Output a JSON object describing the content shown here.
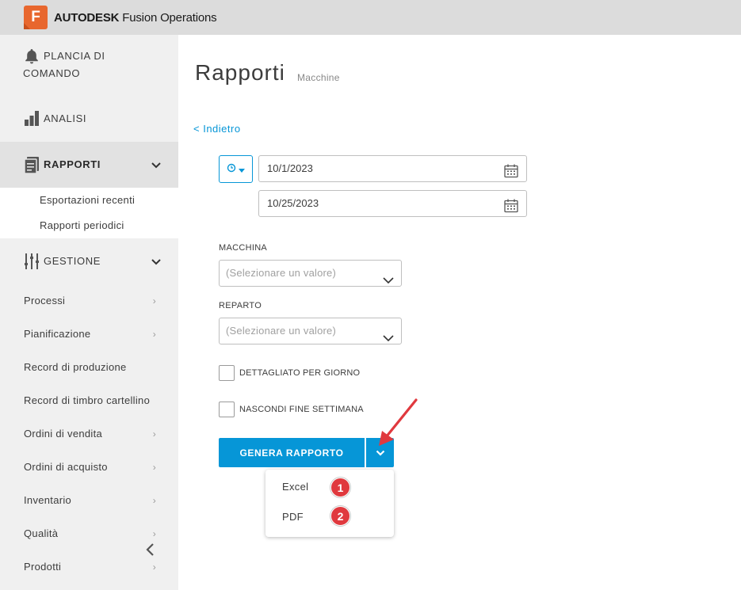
{
  "header": {
    "logo_letter": "F",
    "brand_bold": "AUTODESK",
    "brand_product": "Fusion Operations"
  },
  "sidebar": {
    "dashboard": {
      "label_line1": "PLANCIA DI",
      "label_line2": "COMANDO",
      "icon": "bell-icon"
    },
    "analytics": {
      "label": "ANALISI",
      "icon": "bar-chart-icon"
    },
    "reports": {
      "label": "RAPPORTI",
      "icon": "report-icon",
      "sub_items": [
        "Esportazioni recenti",
        "Rapporti periodici"
      ]
    },
    "management": {
      "label": "GESTIONE",
      "icon": "sliders-icon"
    },
    "items": [
      {
        "label": "Processi",
        "has_arrow": true
      },
      {
        "label": "Pianificazione",
        "has_arrow": true
      },
      {
        "label": "Record di produzione",
        "has_arrow": false
      },
      {
        "label": "Record di timbro cartellino",
        "has_arrow": false
      },
      {
        "label": "Ordini di vendita",
        "has_arrow": true
      },
      {
        "label": "Ordini di acquisto",
        "has_arrow": true
      },
      {
        "label": "Inventario",
        "has_arrow": true
      },
      {
        "label": "Qualità",
        "has_arrow": true
      },
      {
        "label": "Prodotti",
        "has_arrow": true
      }
    ]
  },
  "page": {
    "title": "Rapporti",
    "subtitle": "Macchine",
    "back_label": "< Indietro"
  },
  "filters": {
    "date_from": "10/1/2023",
    "date_to": "10/25/2023",
    "machine_label": "MACCHINA",
    "machine_placeholder": "(Selezionare un valore)",
    "department_label": "REPARTO",
    "department_placeholder": "(Selezionare un valore)",
    "daily_detail_label": "DETTAGLIATO PER GIORNO",
    "hide_weekend_label": "NASCONDI FINE SETTIMANA"
  },
  "actions": {
    "generate_label": "GENERA RAPPORTO",
    "export_options": [
      "Excel",
      "PDF"
    ],
    "badges": [
      "1",
      "2"
    ]
  },
  "colors": {
    "accent": "#0696d7",
    "brand_orange": "#e8672e",
    "annotation_red": "#e0393e"
  }
}
